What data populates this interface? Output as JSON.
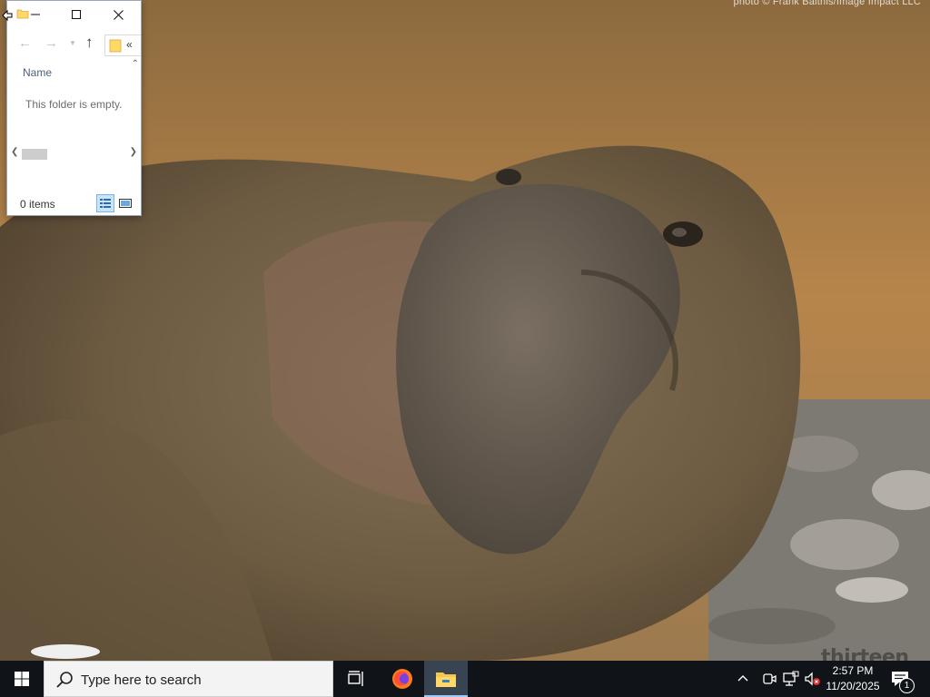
{
  "desktop": {
    "wallpaper_credit": "photo © Frank Balthis/Image Impact LLC",
    "watermark": "thirteen"
  },
  "explorer": {
    "column_header": "Name",
    "empty_message": "This folder is empty.",
    "status": "0 items",
    "colors": {
      "folder": "#ffd866",
      "selection": "#cce4f7"
    }
  },
  "taskbar": {
    "search_placeholder": "Type here to search",
    "pinned": [
      "task-view-icon",
      "firefox-icon",
      "file-explorer-icon"
    ],
    "active_app": "file-explorer",
    "clock": {
      "time": "2:57 PM",
      "date": "11/20/2025"
    },
    "notification_count": "1",
    "colors": {
      "bar": "#101418",
      "active": "#394452",
      "accent": "#9cc9f5"
    }
  }
}
